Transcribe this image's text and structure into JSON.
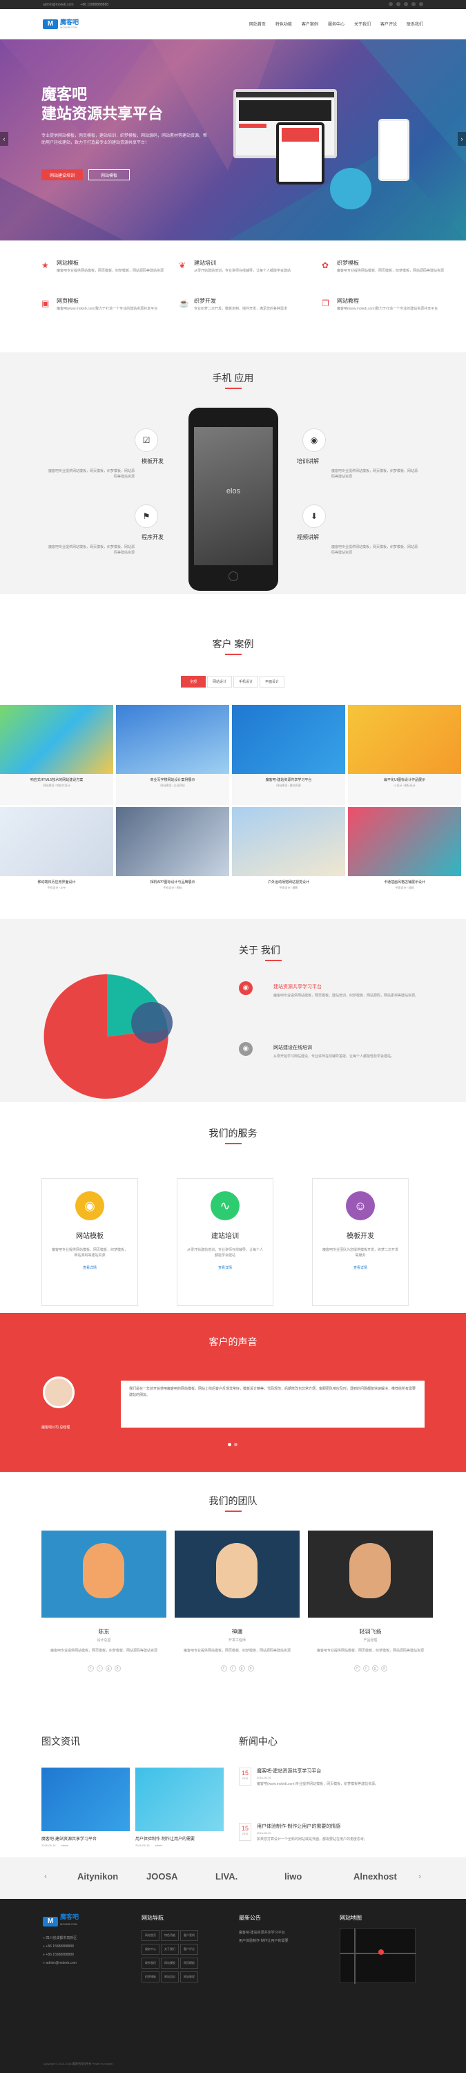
{
  "topbar": {
    "email": "admin@mokeb.com",
    "phone": "+86 15888888888"
  },
  "nav": {
    "logo_title": "魔客吧",
    "logo_sub": "MOKEB.COM",
    "items": [
      "网站首页",
      "特色功能",
      "客户案例",
      "服务中心",
      "关于我们",
      "客户评论",
      "联系我们"
    ]
  },
  "hero": {
    "title1": "魔客吧",
    "title2": "建站资源共享平台",
    "desc": "专业提供网站模板，网页模板，建站培训，织梦模板，网站源码，网站素材等建站资源，帮助用户轻松建站，致力于打造最专业的建站资源共享平台！",
    "btn1": "网站建设培训",
    "btn2": "网站模板",
    "prev": "‹",
    "next": "›",
    "colors": {
      "primary": "#e94444",
      "accent": "#1a7bd1"
    }
  },
  "features": [
    {
      "icon": "star-icon",
      "title": "网站模板",
      "desc": "魔客吧专业提供网站模板，网页模板，织梦模板，网站源码等建站资源"
    },
    {
      "icon": "leaf-icon",
      "title": "建站培训",
      "desc": "从零开始建站培训，专业讲师在线辅导，让每个人都能学会建站"
    },
    {
      "icon": "gift-icon",
      "title": "织梦模板",
      "desc": "魔客吧专业提供网站模板，网页模板，织梦模板，网站源码等建站资源"
    },
    {
      "icon": "image-icon",
      "title": "网页模板",
      "desc": "魔客吧(www.mokeb.com)致力于打造一个专业的建站资源共享平台"
    },
    {
      "icon": "cup-icon",
      "title": "织梦开发",
      "desc": "专业织梦二次开发，模板定制，插件开发，满足您的各种需求"
    },
    {
      "icon": "book-icon",
      "title": "网站教程",
      "desc": "魔客吧(www.mokeb.com)致力于打造一个专业的建站资源共享平台"
    }
  ],
  "mobile": {
    "title": "手机 应用",
    "items": [
      {
        "label": "模板开发",
        "desc": "魔客吧专业提供网站模板，网页模板，织梦模板，网站源码等建站资源"
      },
      {
        "label": "培训讲解",
        "desc": "魔客吧专业提供网站模板，网页模板，织梦模板，网站源码等建站资源"
      },
      {
        "label": "程序开发",
        "desc": "魔客吧专业提供网站模板，网页模板，织梦模板，网站源码等建站资源"
      },
      {
        "label": "视频讲解",
        "desc": "魔客吧专业提供网站模板，网页模板，织梦模板，网站源码等建站资源"
      }
    ],
    "phone_text": "elos"
  },
  "cases": {
    "title": "客户 案例",
    "tabs": [
      "全部",
      "网站设计",
      "手机设计",
      "平面设计"
    ],
    "items": [
      {
        "cap": "响应式HTML5技术的网站建设方案",
        "sub": "网站建设 / 响应式设计"
      },
      {
        "cap": "商业写字楼网站设计案例展示",
        "sub": "网站建设 / 企业网站"
      },
      {
        "cap": "魔客吧-建站资源共享学习平台",
        "sub": "网站建设 / 建站资源"
      },
      {
        "cap": "扁平化UI图标设计作品展示",
        "sub": "UI设计 / 图标设计"
      },
      {
        "cap": "移动端日历应用界面设计",
        "sub": "手机设计 / APP"
      },
      {
        "cap": "相机APP图标设计与品牌展示",
        "sub": "手机设计 / 图标"
      },
      {
        "cap": "户外运动场馆网站视觉设计",
        "sub": "平面设计 / 摄影"
      },
      {
        "cap": "卡通插画风格店铺展示设计",
        "sub": "平面设计 / 插画"
      }
    ]
  },
  "about": {
    "title": "关于 我们",
    "i1_title": "建站资源共享学习平台",
    "i1_desc": "魔客吧专业提供网站模板，网页模板，建站培训，织梦模板，网站源码，网站素材等建站资源。",
    "i2_title": "网站建设在线培训",
    "i2_desc": "从零开始学习网站建设，专业讲师在线辅导答疑，让每个人都能轻松学会建站。"
  },
  "services": {
    "title": "我们的服务",
    "items": [
      {
        "title": "网站模板",
        "desc": "魔客吧专业提供网站模板，网页模板，织梦模板，网站源码等建站资源",
        "more": "查看详情"
      },
      {
        "title": "建站培训",
        "desc": "从零开始建站培训，专业讲师在线辅导，让每个人都能学会建站",
        "more": "查看详情"
      },
      {
        "title": "模板开发",
        "desc": "魔客吧专业团队为您提供模板开发，织梦二次开发等服务",
        "more": "查看详情"
      }
    ]
  },
  "voice": {
    "title": "客户的声音",
    "quote": "我们是在一年前开始使用魔客吧的网站模板，网站上线后客户反馈非常好，模板设计精美，代码规范，后期修改也非常方便。客服团队响应及时，遇到的问题都能快速解决，推荐给所有需要建站的朋友。",
    "name": "魔客吧公司",
    "role": "总经理"
  },
  "team": {
    "title": "我们的团队",
    "members": [
      {
        "name": "陈东",
        "role": "设计总监",
        "desc": "魔客吧专业提供网站模板，网页模板，织梦模板，网站源码等建站资源"
      },
      {
        "name": "神庸",
        "role": "开发工程师",
        "desc": "魔客吧专业提供网站模板，网页模板，织梦模板，网站源码等建站资源"
      },
      {
        "name": "轻羽飞扬",
        "role": "产品经理",
        "desc": "魔客吧专业提供网站模板，网页模板，织梦模板，网站源码等建站资源"
      }
    ]
  },
  "news": {
    "title1": "图文资讯",
    "title2": "新闻中心",
    "pics": [
      {
        "cap": "魔客吧-建站资源共享学习平台",
        "date": "2016-06-16",
        "author": "admin"
      },
      {
        "cap": "用户体验制作·制作让用户的需要",
        "date": "2016-06-16",
        "author": "admin"
      }
    ],
    "items": [
      {
        "day": "15",
        "mon": "2016",
        "title": "魔客吧-建站资源共享学习平台",
        "meta": "2016-06-15",
        "desc": "魔客吧(www.mokeb.com)专业提供网站模板，网页模板，织梦模板等建站资源。"
      },
      {
        "day": "15",
        "mon": "2016",
        "title": "用户体验制作·制作让用户的需要的情感",
        "meta": "2016-06-15",
        "desc": "如果您打算设计一个全新的网站或是界面，都需要站在用户的角度思考。"
      }
    ]
  },
  "brands": [
    "Aitynikon",
    "JOOSA",
    "LIVA.",
    "liwo",
    "Alnexhost"
  ],
  "footer": {
    "contact": [
      "四川省成都市高新区",
      "+86 15888888888",
      "+86 15888888888",
      "admin@mokeb.com"
    ],
    "nav_title": "网站导航",
    "links": [
      "网站首页",
      "特色功能",
      "客户案例",
      "服务中心",
      "关于我们",
      "客户评论",
      "联系我们",
      "网站模板",
      "网页模板",
      "织梦模板",
      "建站培训",
      "网站教程"
    ],
    "notice_title": "最新公告",
    "notices": [
      "魔客吧-建站资源共享学习平台",
      "用户体验制作·制作让用户的需要"
    ],
    "map_title": "网站地图",
    "copyright": "Copyright © 2016-2018 魔客吧版权所有 Power by mokeb"
  }
}
